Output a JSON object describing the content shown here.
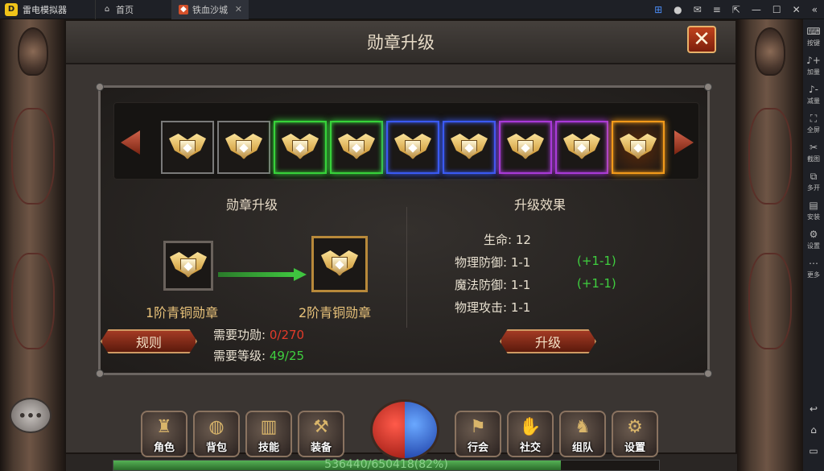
{
  "window": {
    "app_title": "雷电模拟器",
    "tabs": [
      {
        "label": "首页",
        "icon": "home-icon"
      },
      {
        "label": "铁血沙城",
        "icon": "game-icon"
      }
    ],
    "controls": [
      "gamepad-icon",
      "user-icon",
      "mail-icon",
      "menu-icon",
      "external-icon",
      "minimize-icon",
      "maximize-icon",
      "close-icon",
      "collapse-icon"
    ]
  },
  "sidebar": {
    "items": [
      {
        "label": "按键",
        "icon": "keyboard-icon"
      },
      {
        "label": "加量",
        "icon": "volume-up-icon"
      },
      {
        "label": "减量",
        "icon": "volume-down-icon"
      },
      {
        "label": "全屏",
        "icon": "fullscreen-icon"
      },
      {
        "label": "截图",
        "icon": "scissors-icon"
      },
      {
        "label": "多开",
        "icon": "multi-instance-icon"
      },
      {
        "label": "安装",
        "icon": "apk-install-icon"
      },
      {
        "label": "设置",
        "icon": "gear-icon"
      },
      {
        "label": "更多",
        "icon": "more-icon"
      }
    ],
    "bottom": [
      "back-icon",
      "home-icon",
      "recent-apps-icon"
    ]
  },
  "dialog": {
    "title": "勋章升级",
    "close_label": "✕",
    "medal_strip": [
      {
        "tier_color": "#7a7a7a",
        "selected": false
      },
      {
        "tier_color": "#7a7a7a",
        "selected": false
      },
      {
        "tier_color": "#37d23a",
        "selected": false
      },
      {
        "tier_color": "#37d23a",
        "selected": false
      },
      {
        "tier_color": "#3a5af2",
        "selected": false
      },
      {
        "tier_color": "#3a5af2",
        "selected": false
      },
      {
        "tier_color": "#a93ad8",
        "selected": false
      },
      {
        "tier_color": "#a93ad8",
        "selected": false
      },
      {
        "tier_color": "#f29a1a",
        "selected": true
      }
    ],
    "upgrade_section": {
      "title": "勋章升级",
      "from_medal": "1阶青铜勋章",
      "to_medal": "2阶青铜勋章"
    },
    "effect_section": {
      "title": "升级效果",
      "stats": [
        {
          "label": "生命:",
          "value": "12",
          "bonus": ""
        },
        {
          "label": "物理防御:",
          "value": "1-1",
          "bonus": "(+1-1)"
        },
        {
          "label": "魔法防御:",
          "value": "1-1",
          "bonus": "(+1-1)"
        },
        {
          "label": "物理攻击:",
          "value": "1-1",
          "bonus": ""
        }
      ]
    },
    "requirements": {
      "merit_label": "需要功勋:",
      "merit_value": "0/270",
      "level_label": "需要等级:",
      "level_value": "49/25"
    },
    "rules_button": "规则",
    "upgrade_button": "升级"
  },
  "hud": {
    "actions": [
      {
        "label": "角色",
        "icon": "character-icon"
      },
      {
        "label": "背包",
        "icon": "bag-icon"
      },
      {
        "label": "技能",
        "icon": "skill-book-icon"
      },
      {
        "label": "装备",
        "icon": "hammer-icon"
      },
      {
        "label": "行会",
        "icon": "guild-banner-icon"
      },
      {
        "label": "社交",
        "icon": "handshake-icon"
      },
      {
        "label": "组队",
        "icon": "team-icon"
      },
      {
        "label": "设置",
        "icon": "settings-gear-icon"
      }
    ],
    "exp_text": "536440/650418(82%)",
    "exp_fraction": 0.82,
    "chat_label": "•••"
  }
}
